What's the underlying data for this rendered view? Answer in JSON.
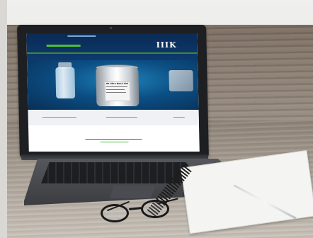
{
  "laptop_screen": {
    "logo_text": "IIIK",
    "product_can_title": "IIK Ultra Bond 100"
  },
  "colors": {
    "site_header_navy": "#0a2a55",
    "site_accent_green": "#4bbf3a",
    "laptop_body": "#3b3d41"
  }
}
